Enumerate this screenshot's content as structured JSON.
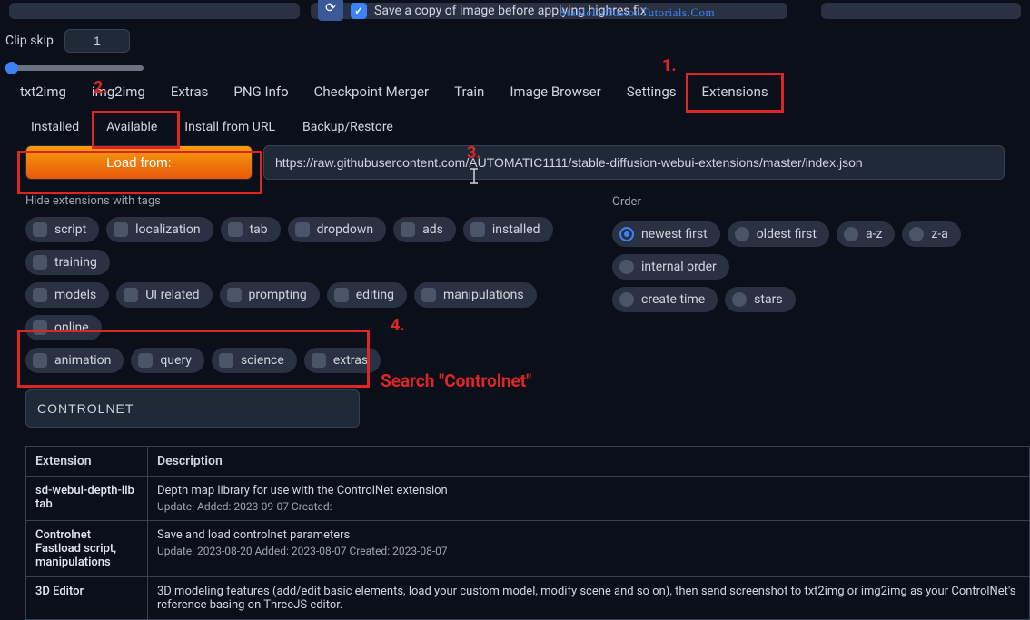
{
  "top": {
    "save_copy_label": "Save a copy of image before applying highres fix",
    "clip_skip_label": "Clip skip",
    "clip_skip_value": "1"
  },
  "watermark": "StableDiffusionTutorials.Com",
  "main_tabs": [
    "txt2img",
    "img2img",
    "Extras",
    "PNG Info",
    "Checkpoint Merger",
    "Train",
    "Image Browser",
    "Settings",
    "Extensions"
  ],
  "sub_tabs": [
    "Installed",
    "Available",
    "Install from URL",
    "Backup/Restore"
  ],
  "load_button": "Load from:",
  "url_value": "https://raw.githubusercontent.com/AUTOMATIC1111/stable-diffusion-webui-extensions/master/index.json",
  "hide_tags_label": "Hide extensions with tags",
  "order_label": "Order",
  "tags_row1": [
    "script",
    "localization",
    "tab",
    "dropdown",
    "ads",
    "installed",
    "training"
  ],
  "tags_row2": [
    "models",
    "UI related",
    "prompting",
    "editing",
    "manipulations",
    "online"
  ],
  "tags_row3": [
    "animation",
    "query",
    "science",
    "extras"
  ],
  "order_row1": [
    "newest first",
    "oldest first",
    "a-z",
    "z-a",
    "internal order"
  ],
  "order_row2": [
    "create time",
    "stars"
  ],
  "search_value": "CONTROLNET",
  "table": {
    "col_extension": "Extension",
    "col_description": "Description",
    "rows": [
      {
        "name": "sd-webui-depth-lib tab",
        "desc": "Depth map library for use with the ControlNet extension",
        "meta": "Update: Added: 2023-09-07 Created:"
      },
      {
        "name": "Controlnet Fastload script, manipulations",
        "desc": "Save and load controlnet parameters",
        "meta": "Update: 2023-08-20 Added: 2023-08-07 Created: 2023-08-07"
      },
      {
        "name": "3D Editor",
        "desc": "3D modeling features (add/edit basic elements, load your custom model, modify scene and so on), then send screenshot to txt2img or img2img as your ControlNet's reference basing on ThreeJS editor.",
        "meta": ""
      }
    ]
  },
  "annotations": {
    "n1": "1.",
    "n2": "2.",
    "n3": "3.",
    "n4": "4.",
    "search_hint": "Search \"Controlnet\""
  }
}
